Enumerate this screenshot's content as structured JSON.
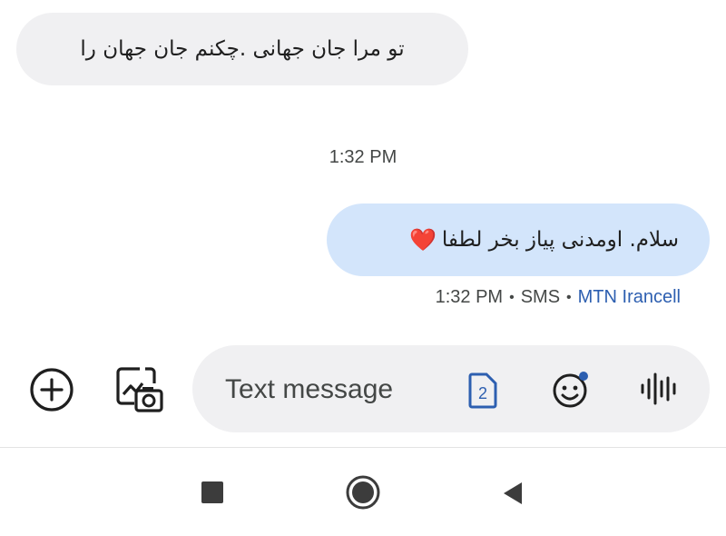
{
  "conversation": {
    "received": {
      "text": "تو مرا جان جهانی .چکنم جان جهان را"
    },
    "timestamp": "1:32 PM",
    "sent": {
      "text": "سلام. اومدنی پیاز بخر لطفا",
      "emoji": "❤️"
    },
    "status": {
      "time": "1:32 PM",
      "separator": "•",
      "type": "SMS",
      "carrier": "MTN Irancell"
    }
  },
  "compose": {
    "placeholder": "Text message",
    "sim_number": "2"
  },
  "colors": {
    "sent_bubble": "#d3e5fb",
    "received_bubble": "#f0f0f2",
    "accent": "#2d5fb0"
  },
  "icons": {
    "add": "add-circle-icon",
    "gallery": "gallery-camera-icon",
    "sim": "sim-card-icon",
    "emoji": "emoji-icon",
    "voice": "voice-waveform-icon",
    "nav_recents": "square-icon",
    "nav_home": "circle-icon",
    "nav_back": "triangle-back-icon"
  }
}
